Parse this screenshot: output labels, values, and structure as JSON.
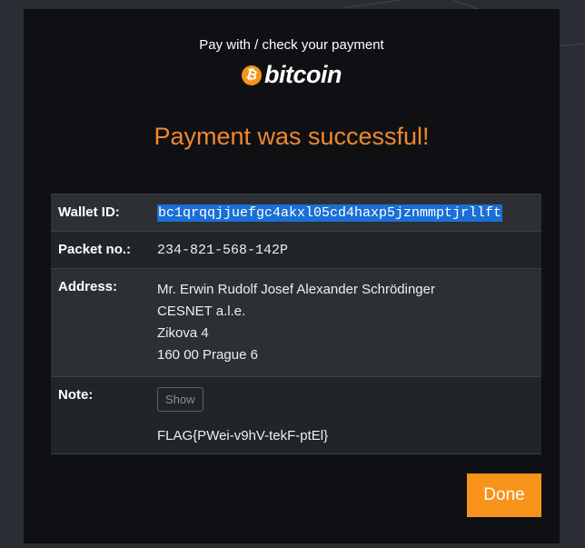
{
  "header": {
    "pay_text": "Pay with / check your payment",
    "brand_symbol": "₿",
    "brand_word": "bitcoin"
  },
  "status": {
    "message": "Payment was successful!"
  },
  "details": {
    "wallet": {
      "label": "Wallet ID:",
      "value": "bc1qrqqjjuefgc4akxl05cd4haxp5jznmmptjrllft"
    },
    "packet": {
      "label": "Packet no.:",
      "value": "234-821-568-142P"
    },
    "address": {
      "label": "Address:",
      "lines": [
        "Mr. Erwin Rudolf Josef Alexander Schrödinger",
        "CESNET a.l.e.",
        "Zikova 4",
        "160 00 Prague 6"
      ]
    },
    "note": {
      "label": "Note:",
      "show_label": "Show",
      "value": "FLAG{PWei-v9hV-tekF-ptEl}"
    }
  },
  "actions": {
    "done_label": "Done"
  },
  "colors": {
    "accent": "#f7931a",
    "success_text": "#f0882f",
    "selection": "#1a6fd6"
  }
}
